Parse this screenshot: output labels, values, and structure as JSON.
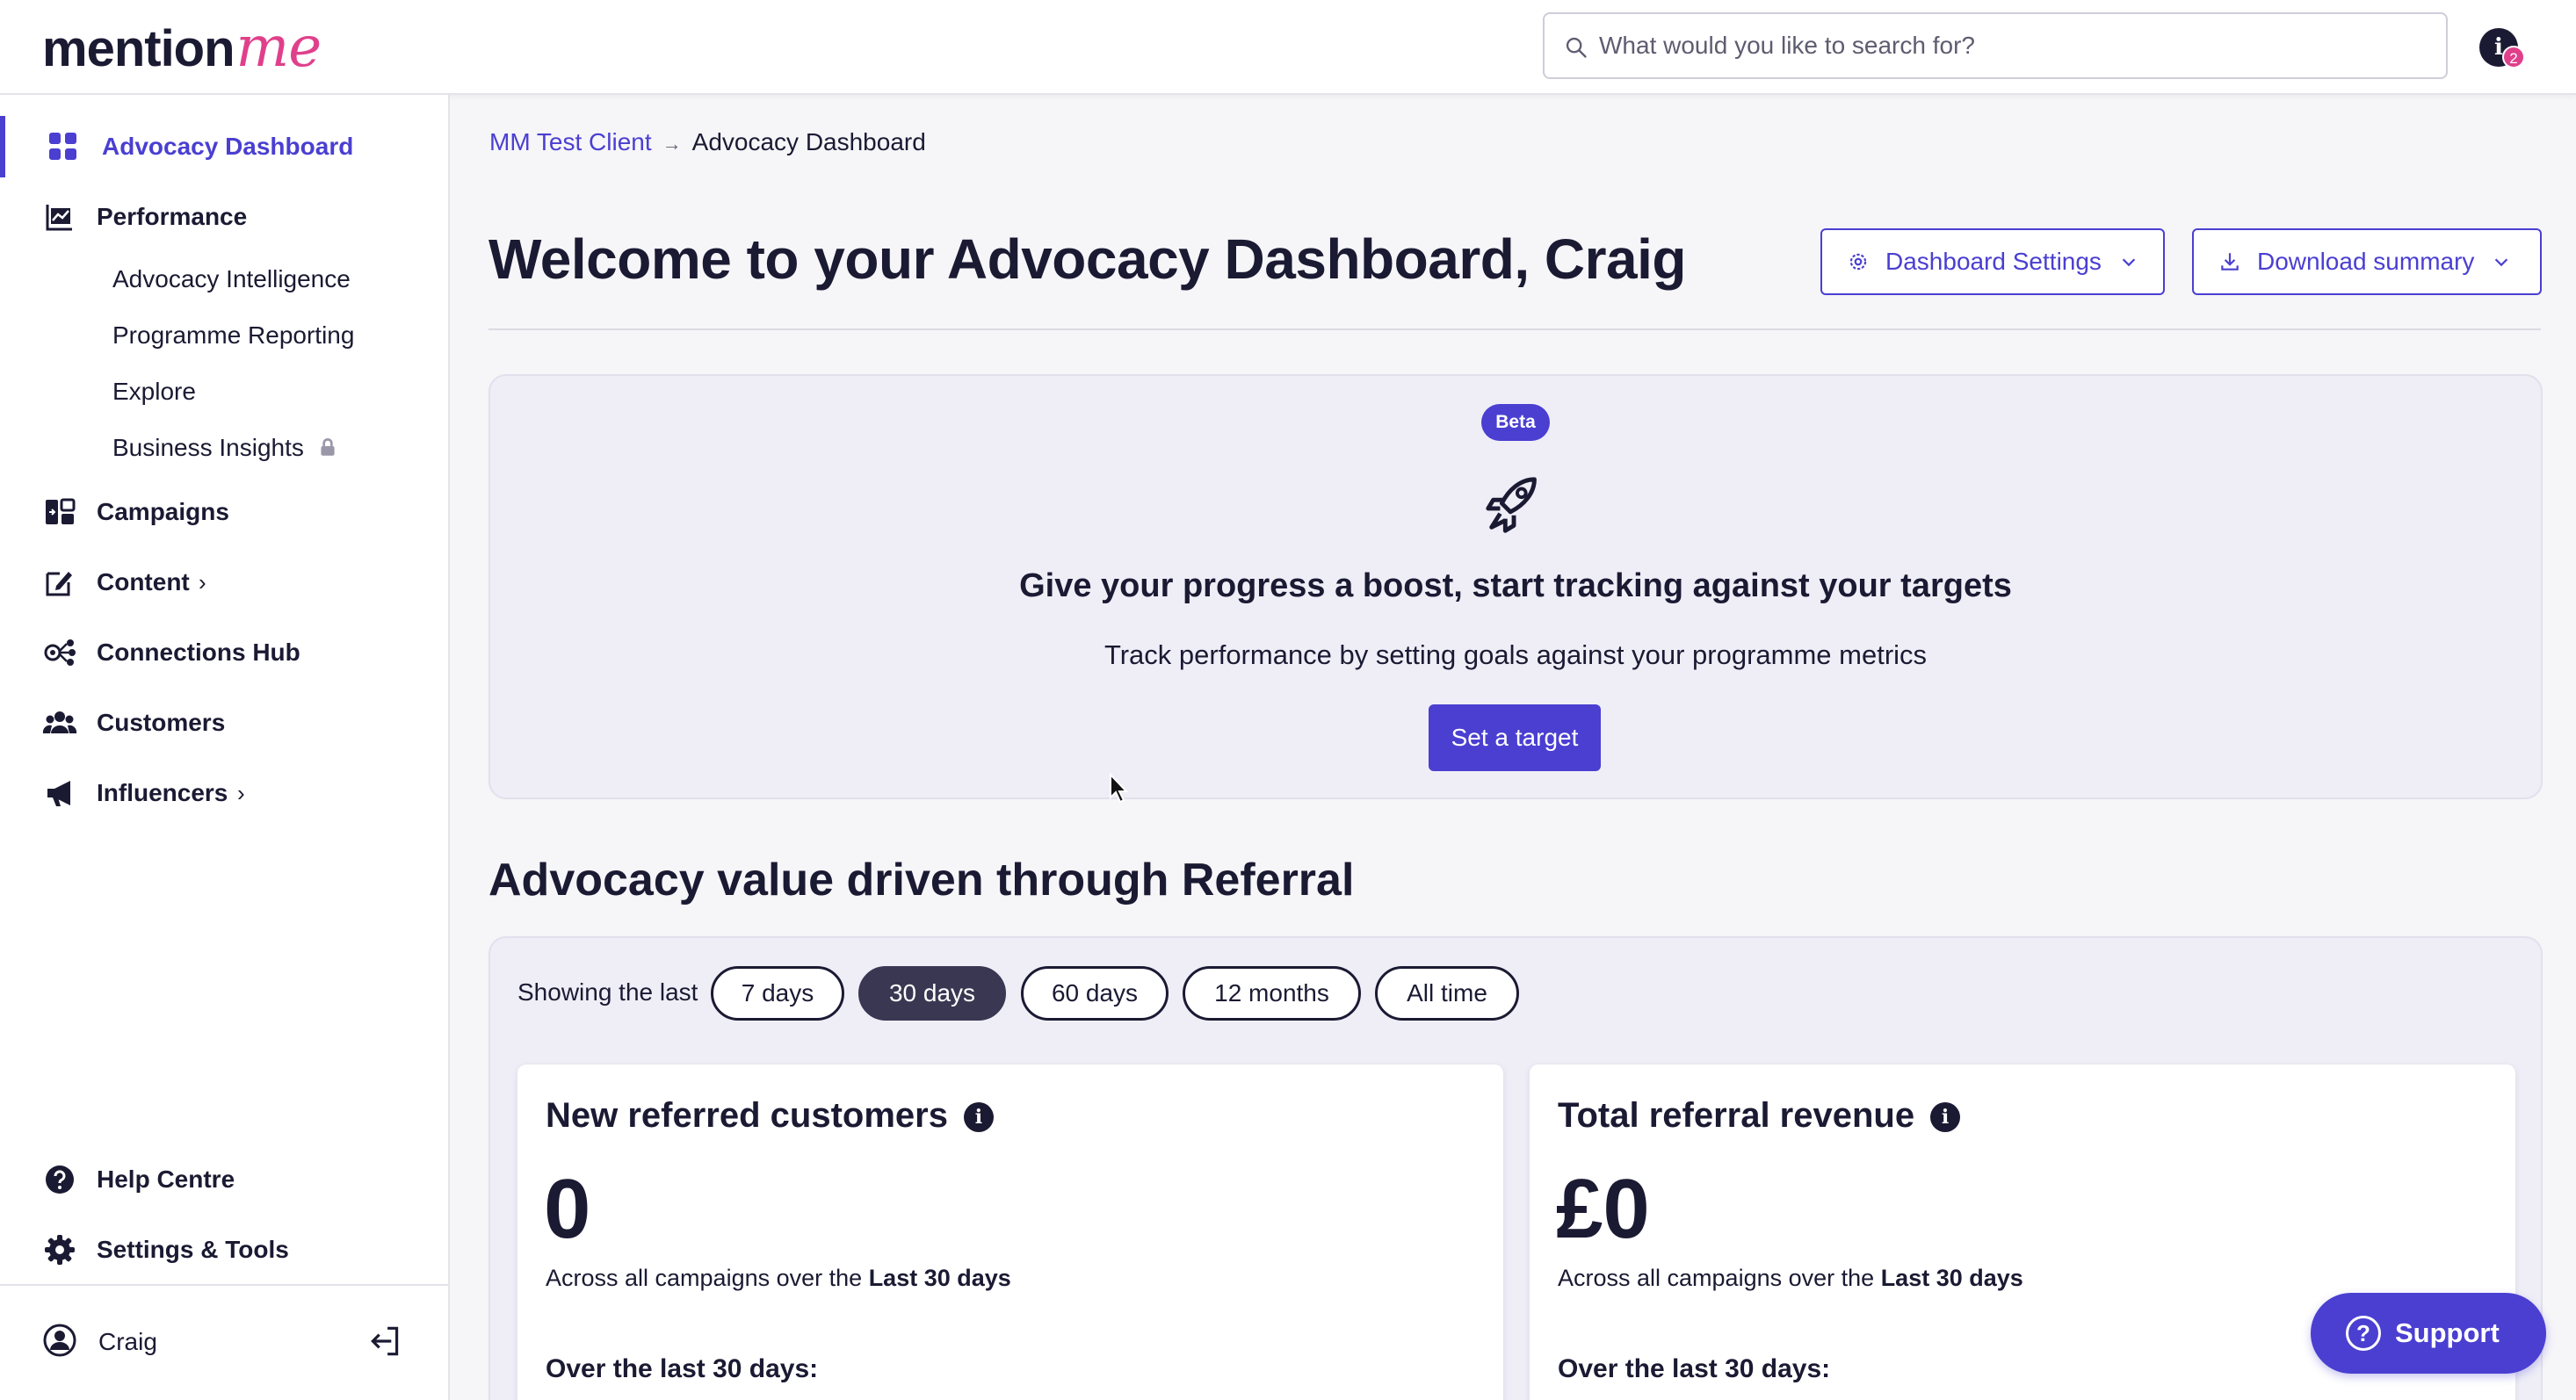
{
  "app": {
    "logo_main": "mention",
    "logo_accent": "me"
  },
  "search": {
    "placeholder": "What would you like to search for?"
  },
  "notifications": {
    "icon_glyph": "i",
    "count": "2"
  },
  "sidebar": {
    "items": [
      {
        "label": "Advocacy Dashboard",
        "icon": "dashboard-grid-icon",
        "active": true
      },
      {
        "label": "Performance",
        "icon": "chart-icon"
      },
      {
        "label": "Campaigns",
        "icon": "campaigns-icon"
      },
      {
        "label": "Content",
        "icon": "edit-icon",
        "chevron": "›"
      },
      {
        "label": "Connections Hub",
        "icon": "connections-icon"
      },
      {
        "label": "Customers",
        "icon": "customers-icon"
      },
      {
        "label": "Influencers",
        "icon": "megaphone-icon",
        "chevron": "›"
      }
    ],
    "performance_sub": [
      {
        "label": "Advocacy Intelligence"
      },
      {
        "label": "Programme Reporting"
      },
      {
        "label": "Explore"
      },
      {
        "label": "Business Insights",
        "locked": true
      }
    ],
    "bottom": [
      {
        "label": "Help Centre",
        "icon": "help-icon"
      },
      {
        "label": "Settings & Tools",
        "icon": "gear-icon"
      }
    ],
    "user": {
      "name": "Craig"
    }
  },
  "breadcrumb": {
    "parent": "MM Test Client",
    "separator": "→",
    "current": "Advocacy Dashboard"
  },
  "header": {
    "title": "Welcome to your Advocacy Dashboard, Craig",
    "settings_button": "Dashboard Settings",
    "download_button": "Download summary"
  },
  "target_card": {
    "badge": "Beta",
    "title": "Give your progress a boost, start tracking against your targets",
    "subtitle": "Track performance by setting goals against your programme metrics",
    "button": "Set a target"
  },
  "advocacy": {
    "section_title": "Advocacy value driven through Referral",
    "showing_label": "Showing the last",
    "periods": [
      "7 days",
      "30 days",
      "60 days",
      "12 months",
      "All time"
    ],
    "selected_period": "30 days",
    "cards": [
      {
        "title": "New referred customers",
        "value": "0",
        "caption_prefix": "Across all campaigns over the",
        "caption_bold": "Last 30 days",
        "sub_heading": "Over the last 30 days:"
      },
      {
        "title": "Total referral revenue",
        "value": "£0",
        "caption_prefix": "Across all campaigns over the",
        "caption_bold": "Last 30 days",
        "sub_heading": "Over the last 30 days:"
      }
    ]
  },
  "support": {
    "label": "Support",
    "icon_glyph": "?"
  },
  "colors": {
    "accent": "#4a3fd1",
    "brand_pink": "#e0408b",
    "text": "#1b1a33",
    "panel": "#efeef7"
  }
}
